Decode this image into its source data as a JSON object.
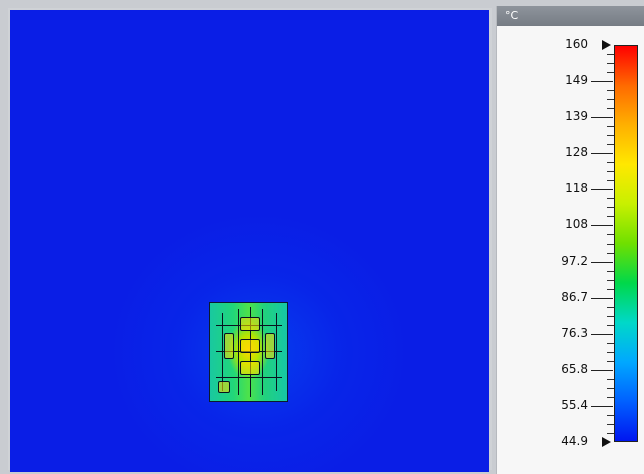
{
  "legend": {
    "unit": "°C",
    "ticks": [
      "160",
      "149",
      "139",
      "128",
      "118",
      "108",
      "97.2",
      "86.7",
      "76.3",
      "65.8",
      "55.4",
      "44.9"
    ],
    "max_value": 160,
    "min_value": 44.9,
    "colormap": [
      "#ff0000",
      "#ff6a00",
      "#ffb000",
      "#ffe800",
      "#c8f000",
      "#6fe000",
      "#00d84a",
      "#00d8c8",
      "#00a8ff",
      "#0060ff",
      "#0016f0"
    ]
  },
  "view": {
    "background_color": "#0a1ee6",
    "board_label": ""
  }
}
